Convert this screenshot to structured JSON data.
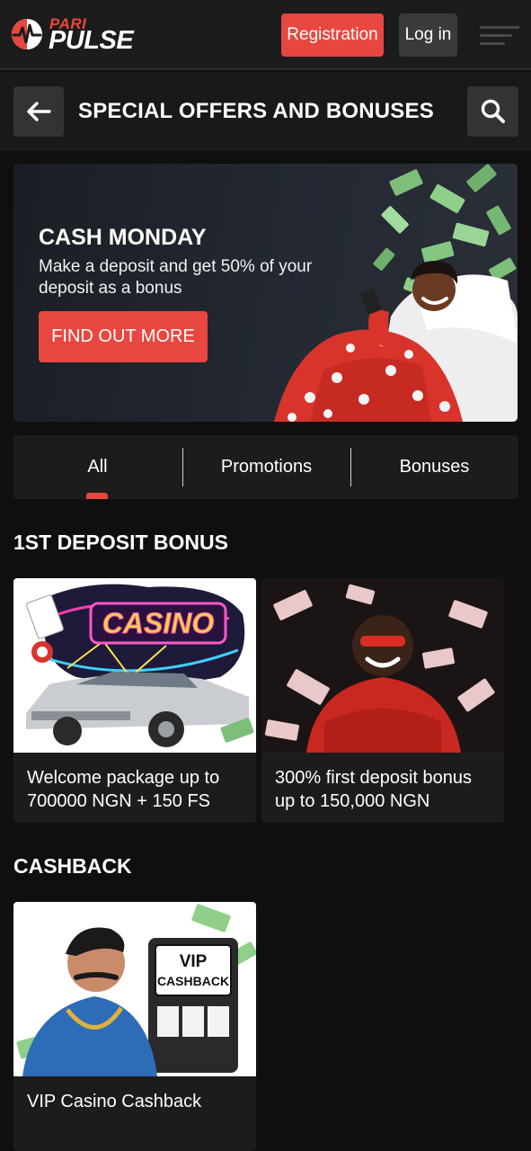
{
  "header": {
    "logo": {
      "top": "PARI",
      "bottom": "PULSE"
    },
    "register_label": "Registration",
    "login_label": "Log in",
    "menu_icon": "hamburger-menu-icon"
  },
  "page": {
    "title": "SPECIAL OFFERS AND BONUSES",
    "back_icon": "arrow-left-icon",
    "search_icon": "search-icon"
  },
  "hero": {
    "title": "CASH MONDAY",
    "description": "Make a deposit and get 50% of your deposit as a bonus",
    "button_label": "FIND OUT MORE"
  },
  "tabs": {
    "items": [
      {
        "label": "All",
        "active": true
      },
      {
        "label": "Promotions",
        "active": false
      },
      {
        "label": "Bonuses",
        "active": false
      }
    ]
  },
  "sections": [
    {
      "title": "1ST DEPOSIT BONUS",
      "cards": [
        {
          "label": "Welcome package up to 700000 NGN + 150 FS",
          "image_text": "CASINO"
        },
        {
          "label": "300% first deposit bonus up to 150,000 NGN"
        }
      ]
    },
    {
      "title": "CASHBACK",
      "cards": [
        {
          "label": "VIP Casino Cashback",
          "image_text_1": "VIP",
          "image_text_2": "CASHBACK"
        }
      ]
    }
  ],
  "colors": {
    "accent": "#e8473f",
    "background": "#0f0f0f",
    "surface": "#1c1c1c",
    "button_dark": "#333333"
  }
}
